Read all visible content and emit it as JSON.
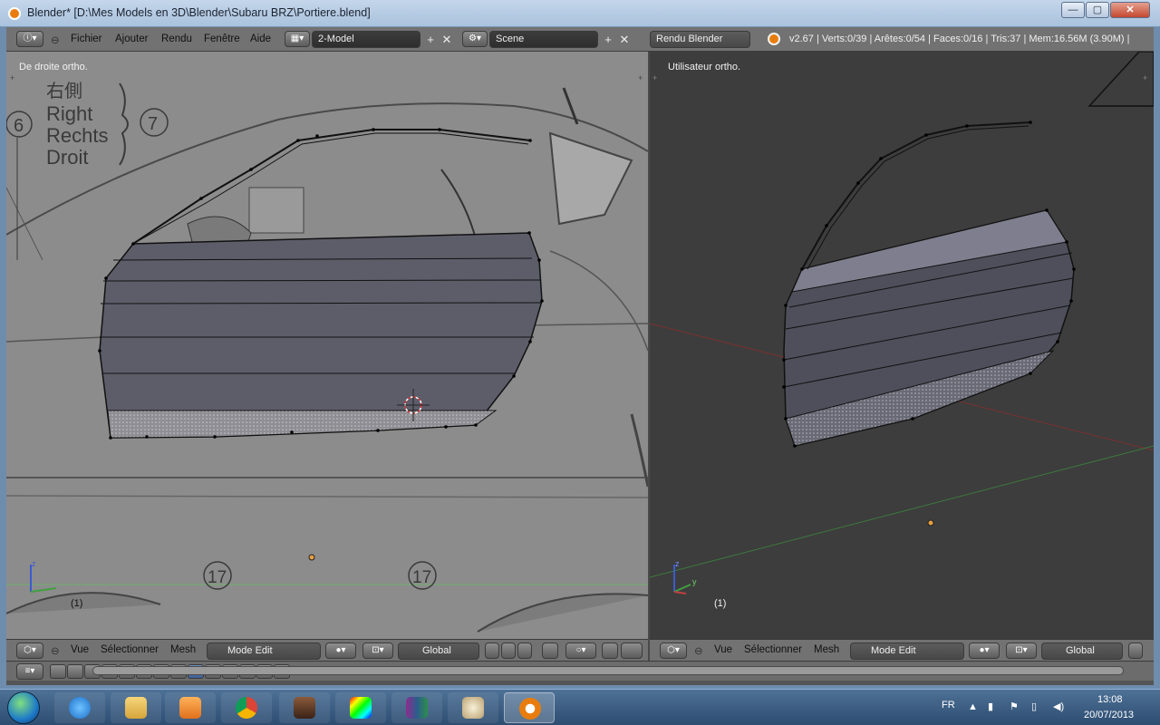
{
  "window": {
    "title": "Blender* [D:\\Mes Models en 3D\\Blender\\Subaru BRZ\\Portiere.blend]",
    "min": "—",
    "max": "▢",
    "close": "✕"
  },
  "info_header": {
    "menus": [
      "Fichier",
      "Ajouter",
      "Rendu",
      "Fenêtre",
      "Aide"
    ],
    "screen_layout": "2-Model",
    "scene": "Scene",
    "render_engine": "Rendu Blender",
    "stats": "v2.67 | Verts:0/39 | Arêtes:0/54 | Faces:0/16 | Tris:37 | Mem:16.56M (3.90M) |"
  },
  "viewport_left": {
    "label": "De droite ortho.",
    "frame": "(1)",
    "reference_text": [
      "右側",
      "Right",
      "Rechts",
      "Droit"
    ],
    "callouts": [
      "6",
      "7",
      "17",
      "17"
    ],
    "axis": "z"
  },
  "viewport_right": {
    "label": "Utilisateur ortho.",
    "frame": "(1)",
    "axes": [
      "z",
      "y"
    ]
  },
  "viewport_header": {
    "menus": [
      "Vue",
      "Sélectionner",
      "Mesh"
    ],
    "mode": "Mode Edit",
    "orientation": "Global"
  },
  "taskbar": {
    "language": "FR",
    "time": "13:08",
    "date": "20/07/2013",
    "apps": [
      "start-menu",
      "internet-explorer",
      "file-explorer",
      "media-player",
      "chrome",
      "game-app",
      "color-app",
      "winrar",
      "paint",
      "blender"
    ]
  },
  "colors": {
    "mesh_face": "#5a5a68",
    "viewport_left_bg": "#8a8a8a",
    "viewport_right_bg": "#3d3d3d",
    "header_bg": "#727272",
    "blender_orange": "#e87d0d"
  }
}
